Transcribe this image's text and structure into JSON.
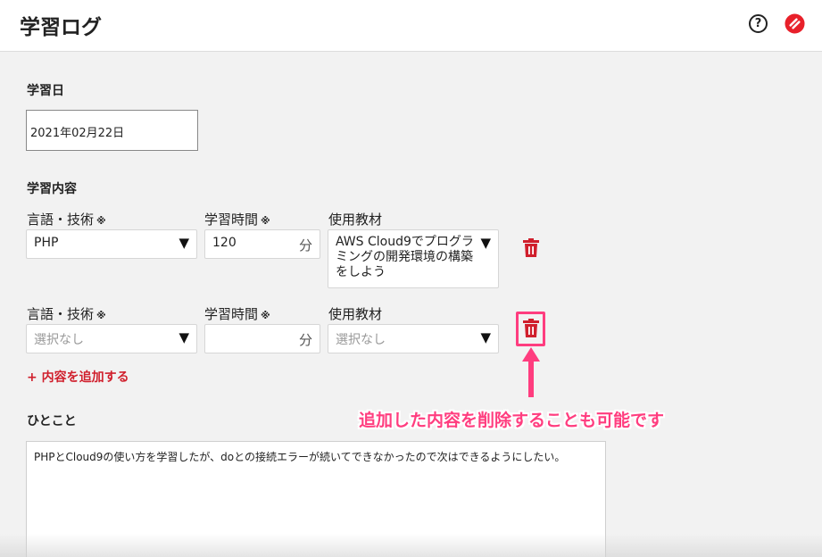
{
  "header": {
    "title": "学習ログ",
    "help_icon": "?"
  },
  "form": {
    "date_label": "学習日",
    "date_value": "2021年02月22日",
    "content_label": "学習内容",
    "columns": {
      "tech": "言語・技術",
      "time": "学習時間",
      "material": "使用教材",
      "required_mark": "※"
    },
    "rows": [
      {
        "tech": "PHP",
        "time": "120",
        "unit": "分",
        "material": "AWS Cloud9でプログラミングの開発環境の構築をしよう",
        "caret": "▼"
      },
      {
        "tech_placeholder": "選択なし",
        "time": "",
        "unit": "分",
        "material_placeholder": "選択なし",
        "caret": "▼"
      }
    ],
    "add_content": "+ 内容を追加する",
    "comment_label": "ひとこと",
    "comment_value": "PHPとCloud9の使い方を学習したが、doとの接続エラーが続いてできなかったので次はできるようにしたい。"
  },
  "annotation": {
    "text": "追加した内容を削除することも可能です"
  },
  "colors": {
    "accent": "#d01f2c",
    "annotation": "#ff3d7f"
  }
}
